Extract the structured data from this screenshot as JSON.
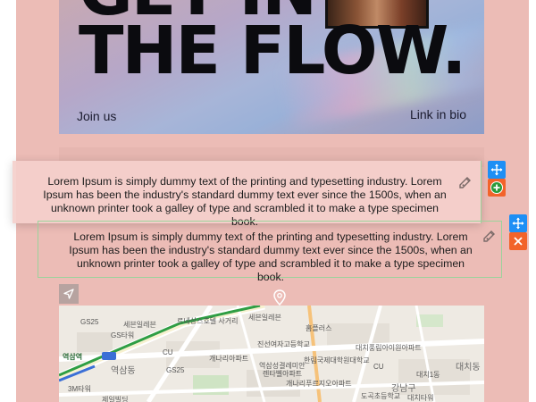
{
  "hero": {
    "title": "GET IN\nTHE FLOW.",
    "join_label": "Join us",
    "bio_label": "Link in bio"
  },
  "blocks": {
    "floating_text": "Lorem Ipsum is simply dummy text of the printing and typesetting industry. Lorem Ipsum has been the industry's standard dummy text ever since the 1500s, when an unknown printer took a galley of type and scrambled it to make a type specimen book.",
    "text_block": "Lorem Ipsum is simply dummy text of the printing and typesetting industry. Lorem Ipsum has been the industry's standard dummy text ever since the 1500s, when an unknown printer took a galley of type and scrambled it to make a type specimen book."
  },
  "controls": {
    "move_icon": "move-icon",
    "add_icon": "plus-icon",
    "delete_icon": "close-icon",
    "edit_icon": "pencil-icon",
    "nav_icon": "navigation-arrow-icon",
    "pin_icon": "map-pin-icon"
  },
  "colors": {
    "page_background": "#ecbcb6",
    "control_blue": "#1e8ff5",
    "control_orange": "#f2632a",
    "selection_outline": "#9bd39b"
  },
  "map": {
    "labels": [
      "GS25",
      "세븐일레븐",
      "르네상스호텔 사거리",
      "세븐일레븐",
      "GS타워",
      "홈플러스",
      "역삼역",
      "CU",
      "GS25",
      "진선여자고등학교",
      "역삼동",
      "개나리아파트",
      "역삼성결레미안",
      "렌타벨아파트",
      "한림국제대학원대학교",
      "대치동",
      "대치풍림아이원아파트",
      "CU",
      "대치1동",
      "개나리푸르지오아파트",
      "도곡초등학교",
      "강남구",
      "3M타워",
      "제일빌딩",
      "대치타워"
    ]
  }
}
